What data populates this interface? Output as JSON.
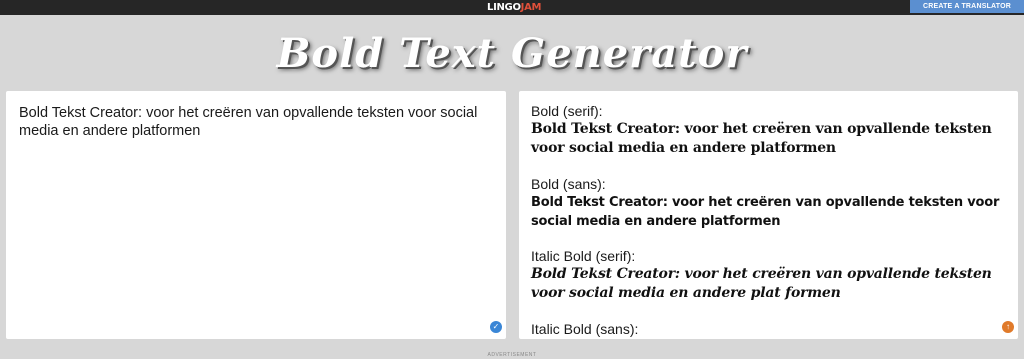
{
  "header": {
    "logo_part1": "LINGO",
    "logo_part2": "JAM",
    "cta_label": "CREATE A TRANSLATOR"
  },
  "page_title": "Bold Text Generator",
  "input": {
    "text": "Bold Tekst Creator: voor het creëren van opvallende teksten voor social media en andere platformen"
  },
  "outputs": [
    {
      "label": "Bold (serif):",
      "text": "Bold Tekst Creator: voor het creëren van opvallende teksten voor social media en andere platformen"
    },
    {
      "label": "Bold (sans):",
      "text": "Bold Tekst Creator: voor het creëren van opvallende teksten voor social media en andere platformen"
    },
    {
      "label": "Italic Bold (serif):",
      "text": "Bold Tekst Creator: voor het creëren van opvallende teksten voor social media en andere plat formen"
    },
    {
      "label": "Italic Bold (sans):",
      "text": ""
    }
  ],
  "footer": {
    "ad_label": "ADVERTISEMENT"
  },
  "icons": {
    "check": "check-circle-icon",
    "arrow": "arrow-up-circle-icon"
  },
  "colors": {
    "topbar": "#262626",
    "cta": "#5b8fd0",
    "logo_accent": "#e0503a",
    "background": "#d7d7d7"
  }
}
